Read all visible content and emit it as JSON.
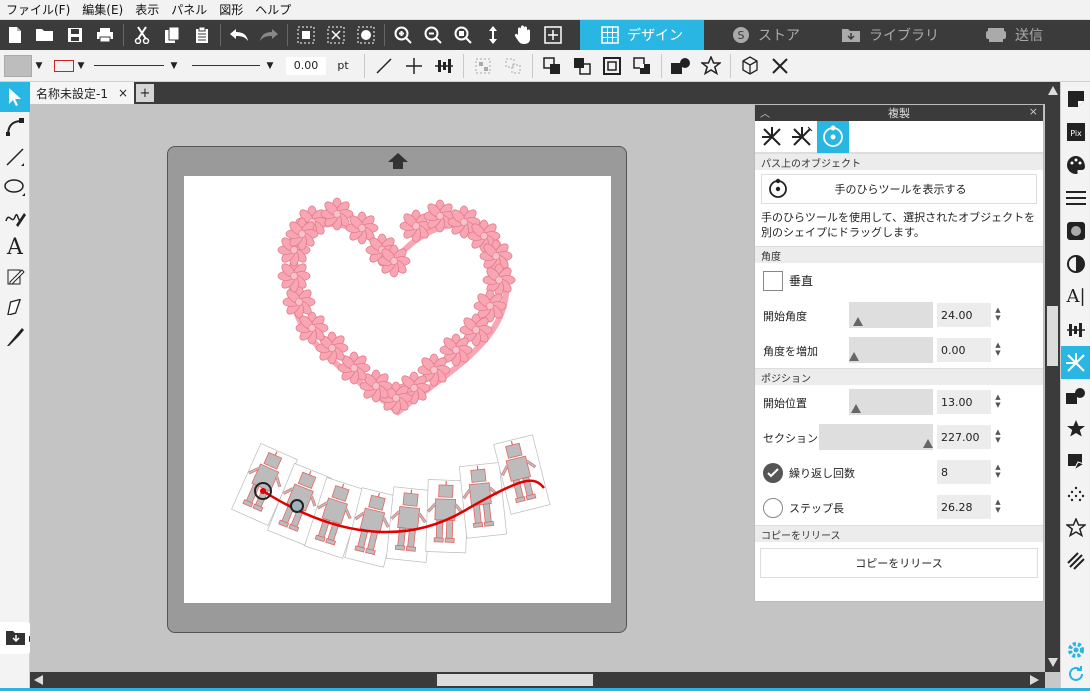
{
  "menu": [
    "ファイル(F)",
    "編集(E)",
    "表示",
    "パネル",
    "図形",
    "ヘルプ"
  ],
  "nav_tabs": {
    "design": "デザイン",
    "store": "ストア",
    "library": "ライブラリ",
    "send": "送信"
  },
  "toolbar2": {
    "line_width_value": "0.00",
    "line_width_unit": "pt"
  },
  "document_tab": {
    "name": "名称未設定-1",
    "close": "×",
    "add": "+"
  },
  "panel": {
    "title": "複製",
    "section_path_object": "パス上のオブジェクト",
    "show_hand_tool_button": "手のひらツールを表示する",
    "description": "手のひらツールを使用して、選択されたオブジェクトを別のシェイプにドラッグします。",
    "section_angle": "角度",
    "vertical_label": "垂直",
    "start_angle_label": "開始角度",
    "start_angle_value": "24.00",
    "angle_increment_label": "角度を増加",
    "angle_increment_value": "0.00",
    "section_position": "ポジション",
    "start_position_label": "開始位置",
    "start_position_value": "13.00",
    "section_length_label": "セクションの長さ",
    "section_length_value": "227.00",
    "repeat_count_label": "繰り返し回数",
    "repeat_count_value": "8",
    "step_length_label": "ステップ長",
    "step_length_value": "26.28",
    "section_release": "コピーをリリース",
    "release_button": "コピーをリリース"
  },
  "colors": {
    "accent": "#29b6e3",
    "dark_bar": "#3b3b3b",
    "flower": "#f9a6b4",
    "path_red": "#e00000"
  }
}
